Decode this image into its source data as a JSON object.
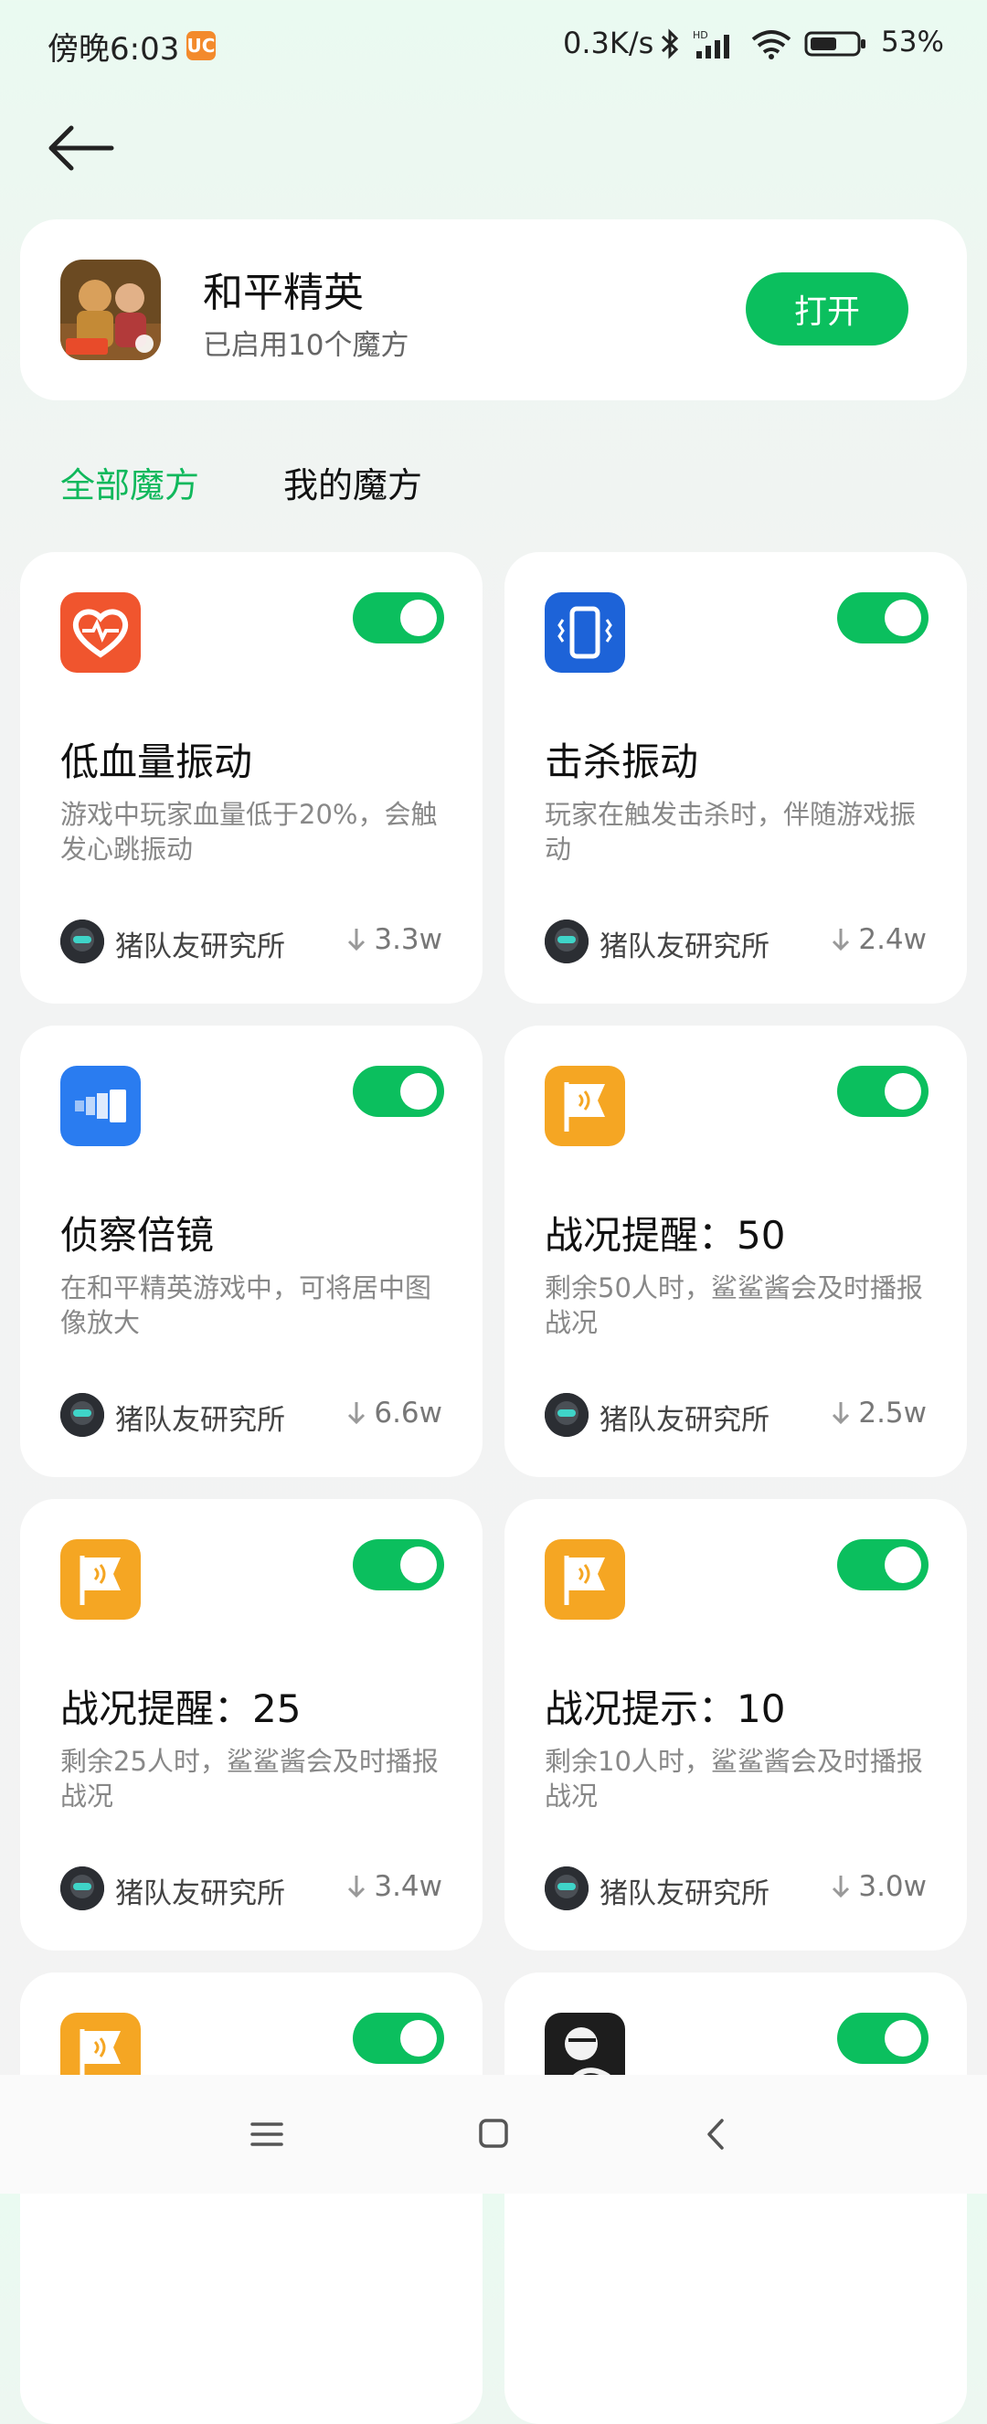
{
  "status": {
    "time": "傍晚6:03",
    "speed": "0.3K/s",
    "battery": "53%",
    "hd": "HD",
    "uc_icon": "uc-browser-icon"
  },
  "header": {
    "back_icon": "arrow-left-icon"
  },
  "app": {
    "name": "和平精英",
    "subtitle": "已启用10个魔方",
    "open_label": "打开"
  },
  "tabs": [
    {
      "label": "全部魔方",
      "active": true
    },
    {
      "label": "我的魔方",
      "active": false
    }
  ],
  "cards": [
    {
      "title": "低血量振动",
      "desc": "游戏中玩家血量低于20%，会触发心跳振动",
      "author": "猪队友研究所",
      "downloads": "3.3w",
      "icon": "heart-icon",
      "enabled": true
    },
    {
      "title": "击杀振动",
      "desc": "玩家在触发击杀时，伴随游戏振动",
      "author": "猪队友研究所",
      "downloads": "2.4w",
      "icon": "vibration-icon",
      "enabled": true
    },
    {
      "title": "侦察倍镜",
      "desc": "在和平精英游戏中，可将居中图像放大",
      "author": "猪队友研究所",
      "downloads": "6.6w",
      "icon": "scope-icon",
      "enabled": true
    },
    {
      "title": "战况提醒：50",
      "desc": "剩余50人时，鲨鲨酱会及时播报战况",
      "author": "猪队友研究所",
      "downloads": "2.5w",
      "icon": "flag-icon",
      "enabled": true
    },
    {
      "title": "战况提醒：25",
      "desc": "剩余25人时，鲨鲨酱会及时播报战况",
      "author": "猪队友研究所",
      "downloads": "3.4w",
      "icon": "flag-icon",
      "enabled": true
    },
    {
      "title": "战况提示：10",
      "desc": "剩余10人时，鲨鲨酱会及时播报战况",
      "author": "猪队友研究所",
      "downloads": "3.0w",
      "icon": "flag-icon",
      "enabled": true
    },
    {
      "title": "",
      "desc": "",
      "author": "",
      "downloads": "",
      "icon": "flag-icon",
      "enabled": true
    },
    {
      "title": "",
      "desc": "",
      "author": "",
      "downloads": "",
      "icon": "sketch-character-icon",
      "enabled": true
    }
  ],
  "colors": {
    "accent": "#0bbf5e",
    "tab_active": "#10b85c",
    "heart_icon_bg": "#f0552e",
    "vibration_icon_bg": "#1d63d8",
    "scope_icon_bg": "#2a7cf0",
    "flag_icon_bg": "#f5a623"
  },
  "navbar": {
    "menu_icon": "menu-icon",
    "home_icon": "home-square-icon",
    "back_icon": "back-chevron-icon"
  }
}
